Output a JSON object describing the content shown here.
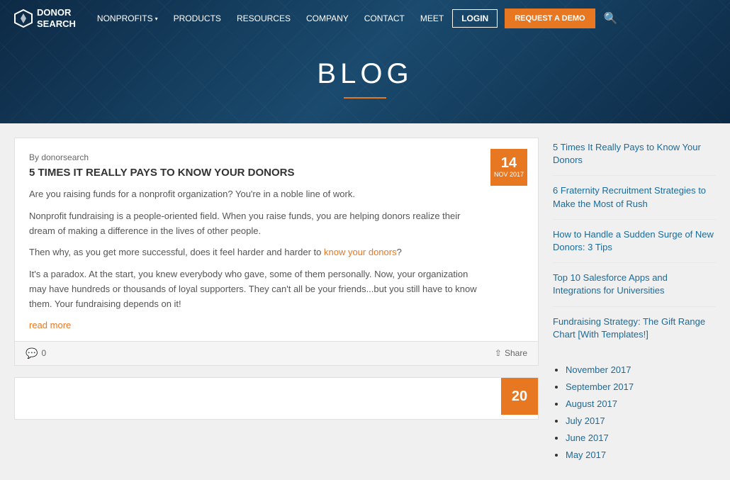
{
  "header": {
    "logo": {
      "line1": "DONOR",
      "line2": "SEARCH"
    },
    "nav": [
      {
        "label": "NONPROFITS",
        "has_dropdown": true
      },
      {
        "label": "PRODUCTS",
        "has_dropdown": false
      },
      {
        "label": "RESOURCES",
        "has_dropdown": false
      },
      {
        "label": "COMPANY",
        "has_dropdown": false
      },
      {
        "label": "CONTACT",
        "has_dropdown": false
      },
      {
        "label": "MEET",
        "has_dropdown": false
      }
    ],
    "login_label": "LOGIN",
    "demo_label": "REQUEST A DEMO"
  },
  "hero": {
    "title": "BLOG",
    "underline_color": "#e87722"
  },
  "article1": {
    "by": "By donorsearch",
    "heading": "5 TIMES IT REALLY PAYS TO KNOW YOUR DONORS",
    "badge_day": "14",
    "badge_month": "NOV 2017",
    "para1": "Are you raising funds for a nonprofit organization? You're in a noble line of work.",
    "para2": "Nonprofit fundraising is a people-oriented field. When you raise funds, you are helping donors realize their dream of making a difference in the lives of other people.",
    "para3_before": "Then why, as you get more successful, does it feel harder and harder to ",
    "para3_link": "know your donors",
    "para3_after": "?",
    "para4": "It's a paradox. At the start, you knew everybody who gave, some of them personally. Now, your organization may have hundreds or thousands of loyal supporters. They can't all be your friends...but you still have to know them. Your fundraising depends on it!",
    "read_more": "read more",
    "comments_count": "0",
    "share_label": "Share"
  },
  "article2": {
    "badge_day": "20"
  },
  "sidebar": {
    "related_posts": [
      {
        "text": "5 Times It Really Pays to Know Your Donors"
      },
      {
        "text": "6 Fraternity Recruitment Strategies to Make the Most of Rush"
      },
      {
        "text": "How to Handle a Sudden Surge of New Donors: 3 Tips"
      },
      {
        "text": "Top 10 Salesforce Apps and Integrations for Universities"
      },
      {
        "text": "Fundraising Strategy: The Gift Range Chart [With Templates!]"
      }
    ],
    "archives": [
      {
        "label": "November 2017"
      },
      {
        "label": "September 2017"
      },
      {
        "label": "August 2017"
      },
      {
        "label": "July 2017"
      },
      {
        "label": "June 2017"
      },
      {
        "label": "May 2017"
      }
    ]
  }
}
